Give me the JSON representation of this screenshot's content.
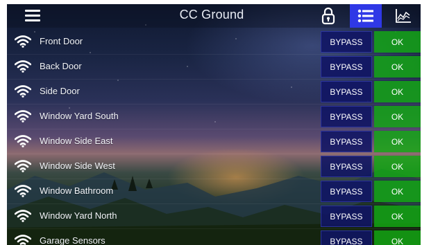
{
  "header": {
    "title": "CC Ground",
    "icons": [
      "menu-icon",
      "lock-icon",
      "list-icon",
      "chart-icon"
    ],
    "active_tab": "list"
  },
  "colors": {
    "active_tab": "#2f38e6",
    "bypass_bg": "#10146a",
    "ok_bg": "#14aa14",
    "text": "#ffffff"
  },
  "zones": [
    {
      "name": "Front Door",
      "bypass_label": "BYPASS",
      "status": "OK"
    },
    {
      "name": "Back Door",
      "bypass_label": "BYPASS",
      "status": "OK"
    },
    {
      "name": "Side Door",
      "bypass_label": "BYPASS",
      "status": "OK"
    },
    {
      "name": "Window Yard South",
      "bypass_label": "BYPASS",
      "status": "OK"
    },
    {
      "name": "Window Side East",
      "bypass_label": "BYPASS",
      "status": "OK"
    },
    {
      "name": "Window Side West",
      "bypass_label": "BYPASS",
      "status": "OK"
    },
    {
      "name": "Window Bathroom",
      "bypass_label": "BYPASS",
      "status": "OK"
    },
    {
      "name": "Window Yard North",
      "bypass_label": "BYPASS",
      "status": "OK"
    },
    {
      "name": "Garage Sensors",
      "bypass_label": "BYPASS",
      "status": "OK"
    }
  ]
}
